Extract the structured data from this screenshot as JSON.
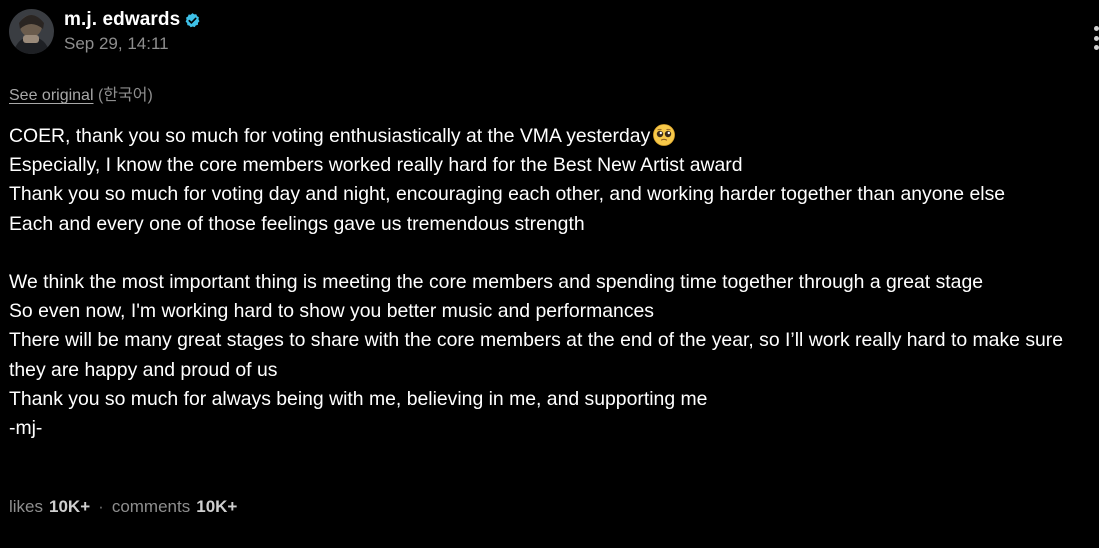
{
  "post": {
    "username": "m.j. edwards",
    "timestamp": "Sep 29, 14:11",
    "see_original_label": "See original",
    "original_language": "(한국어)",
    "lines": [
      "COER, thank you so much for voting enthusiastically at the VMA yesterday",
      "Especially, I know the core members worked really hard for the Best New Artist award",
      "Thank you so much for voting day and night, encouraging each other, and working harder together than anyone else",
      "Each and every one of those feelings gave us tremendous strength",
      "",
      "We think the most important thing is meeting the core members and spending time together through a great stage",
      "So even now, I'm working hard to show you better music and performances",
      "There will be many great stages to share with the core members at the end of the year, so I’ll work really hard to make sure they are happy and proud of us",
      "Thank you so much for always being with me, believing in me, and supporting me",
      "-mj-"
    ],
    "emoji": "pleading-face-emoji"
  },
  "footer": {
    "likes_label": "likes",
    "likes_count": "10K+",
    "separator": "·",
    "comments_label": "comments",
    "comments_count": "10K+"
  },
  "colors": {
    "background": "#000000",
    "text": "#ffffff",
    "muted": "#8e8e8e",
    "verified": "#3ec1e8"
  },
  "icons": {
    "verified": "verified-badge-icon",
    "more": "more-options-icon"
  }
}
